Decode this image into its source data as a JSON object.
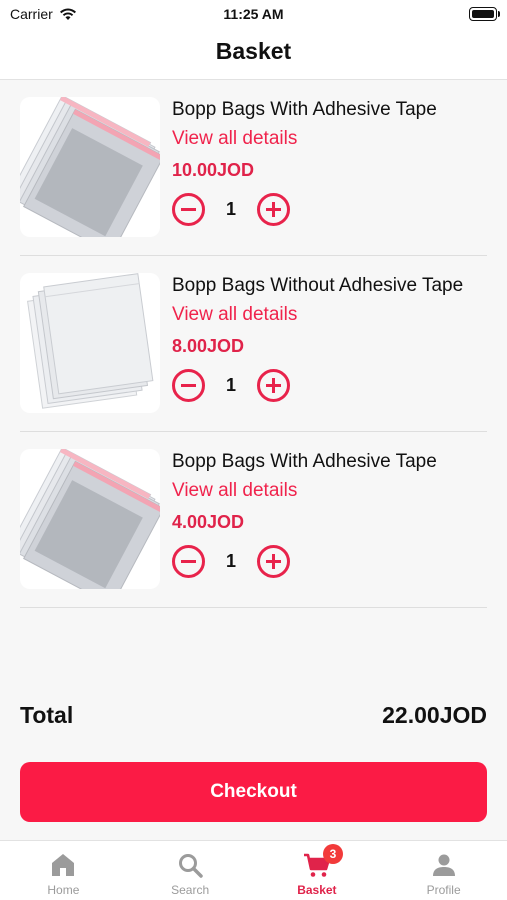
{
  "status_bar": {
    "carrier": "Carrier",
    "time": "11:25 AM"
  },
  "header": {
    "title": "Basket"
  },
  "items": [
    {
      "name": "Bopp Bags With Adhesive Tape",
      "details_label": "View all details",
      "price": "10.00JOD",
      "quantity": "1",
      "image": "adhesive-bags"
    },
    {
      "name": "Bopp Bags Without Adhesive Tape",
      "details_label": "View all details",
      "price": "8.00JOD",
      "quantity": "1",
      "image": "plain-bags"
    },
    {
      "name": "Bopp Bags With Adhesive Tape",
      "details_label": "View all details",
      "price": "4.00JOD",
      "quantity": "1",
      "image": "adhesive-bags"
    }
  ],
  "summary": {
    "total_label": "Total",
    "total_value": "22.00JOD"
  },
  "checkout": {
    "label": "Checkout"
  },
  "tabs": [
    {
      "label": "Home",
      "icon": "home-icon"
    },
    {
      "label": "Search",
      "icon": "search-icon"
    },
    {
      "label": "Basket",
      "icon": "cart-icon",
      "active": true,
      "badge": "3"
    },
    {
      "label": "Profile",
      "icon": "profile-icon"
    }
  ],
  "colors": {
    "accent": "#fb1b45",
    "price": "#e0234a",
    "inactive_tab": "#9b9b9b",
    "badge": "#f23a3a"
  }
}
